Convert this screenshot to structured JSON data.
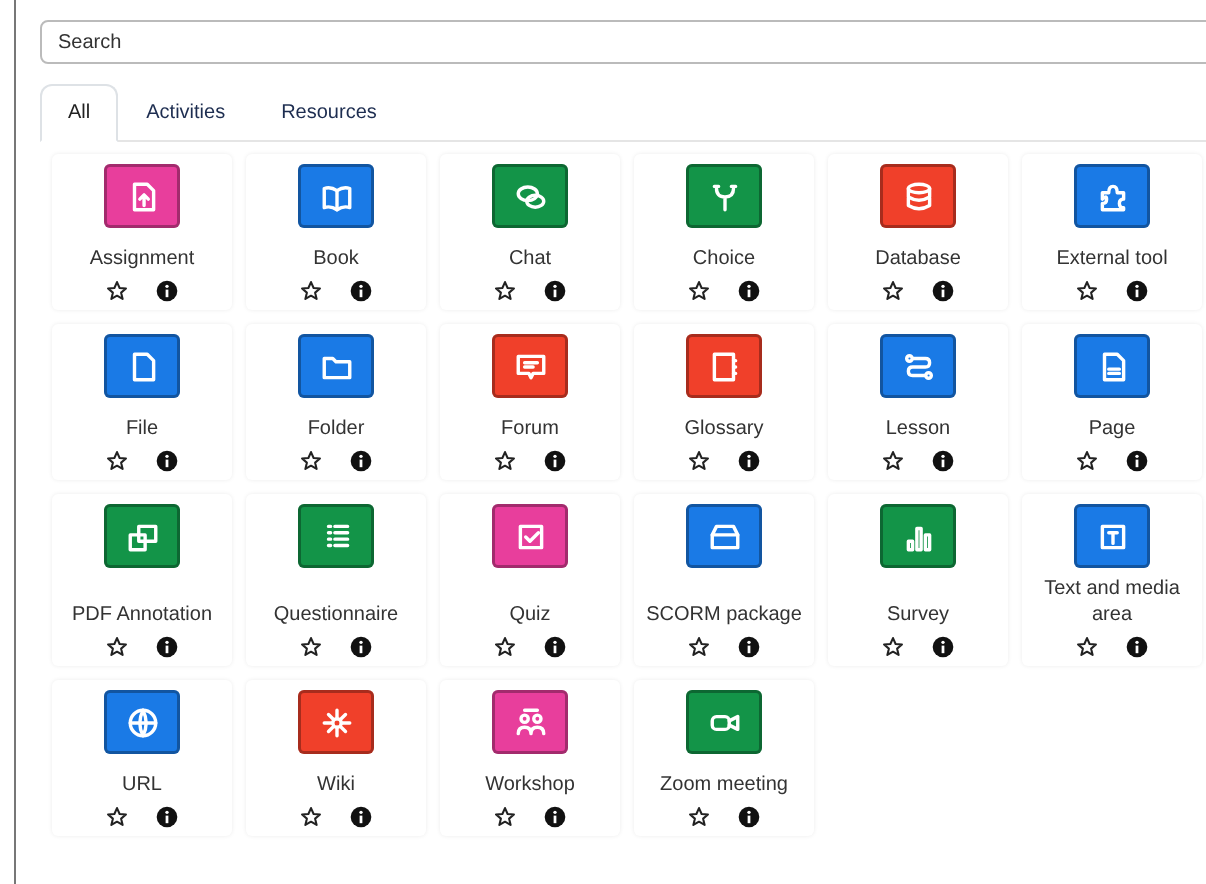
{
  "search": {
    "placeholder": "Search"
  },
  "tabs": [
    {
      "label": "All",
      "selected": true
    },
    {
      "label": "Activities",
      "selected": false
    },
    {
      "label": "Resources",
      "selected": false
    }
  ],
  "modules": [
    {
      "name": "Assignment",
      "color": "#e83e9c",
      "starred": false
    },
    {
      "name": "Book",
      "color": "#1a7ae6",
      "starred": false
    },
    {
      "name": "Chat",
      "color": "#139448",
      "starred": false
    },
    {
      "name": "Choice",
      "color": "#139448",
      "starred": false
    },
    {
      "name": "Database",
      "color": "#f0402a",
      "starred": false
    },
    {
      "name": "External tool",
      "color": "#1a7ae6",
      "starred": false
    },
    {
      "name": "File",
      "color": "#1a7ae6",
      "starred": false
    },
    {
      "name": "Folder",
      "color": "#1a7ae6",
      "starred": false
    },
    {
      "name": "Forum",
      "color": "#f0402a",
      "starred": false
    },
    {
      "name": "Glossary",
      "color": "#f0402a",
      "starred": false
    },
    {
      "name": "Lesson",
      "color": "#1a7ae6",
      "starred": false
    },
    {
      "name": "Page",
      "color": "#1a7ae6",
      "starred": false
    },
    {
      "name": "PDF Annotation",
      "color": "#139448",
      "starred": false
    },
    {
      "name": "Questionnaire",
      "color": "#139448",
      "starred": false
    },
    {
      "name": "Quiz",
      "color": "#e83e9c",
      "starred": false
    },
    {
      "name": "SCORM package",
      "color": "#1a7ae6",
      "starred": false
    },
    {
      "name": "Survey",
      "color": "#139448",
      "starred": false
    },
    {
      "name": "Text and media area",
      "color": "#1a7ae6",
      "starred": false
    },
    {
      "name": "URL",
      "color": "#1a7ae6",
      "starred": false
    },
    {
      "name": "Wiki",
      "color": "#f0402a",
      "starred": false
    },
    {
      "name": "Workshop",
      "color": "#e83e9c",
      "starred": false
    },
    {
      "name": "Zoom meeting",
      "color": "#139448",
      "starred": false
    }
  ]
}
